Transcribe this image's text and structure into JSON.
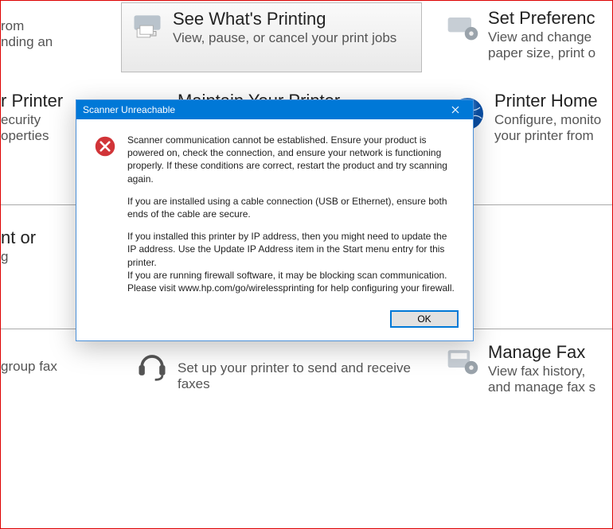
{
  "grid": {
    "row1": {
      "col1": {
        "title_frag": "rom",
        "desc_frag": "nding an"
      },
      "col2": {
        "title": "See What's Printing",
        "desc": "View, pause, or cancel your print jobs"
      },
      "col3": {
        "title": "Set Preferenc",
        "desc": "View and change\npaper size, print o"
      }
    },
    "row2": {
      "col1": {
        "title": "r Printer",
        "desc": "ecurity\noperties"
      },
      "col2": {
        "title": "Maintain Your Printer"
      },
      "col3": {
        "title": "Printer Home",
        "desc": "Configure, monito\nyour printer from"
      }
    },
    "row3": {
      "col1": {
        "title": "nt or",
        "desc": "g"
      }
    },
    "row4": {
      "col1": {
        "desc_frag": "group fax"
      },
      "col2": {
        "desc": "Set up your printer to send and receive faxes"
      },
      "col3": {
        "title": "Manage Fax",
        "desc": "View fax history,\nand manage fax s"
      }
    }
  },
  "dialog": {
    "title": "Scanner Unreachable",
    "p1": "Scanner communication cannot be established.  Ensure your product is powered on, check the connection, and ensure your network is functioning properly.  If these conditions are correct, restart the product and try scanning again.",
    "p2": "If you are installed using a cable connection (USB or Ethernet), ensure both ends of the cable are secure.",
    "p3": "If you installed this printer by IP address, then you might need to update the IP address.  Use the Update IP Address item in the Start menu entry for this printer.",
    "p4": "If you are running firewall software, it may be blocking scan communication.  Please visit www.hp.com/go/wirelessprinting for help configuring your firewall.",
    "ok_label": "OK"
  }
}
